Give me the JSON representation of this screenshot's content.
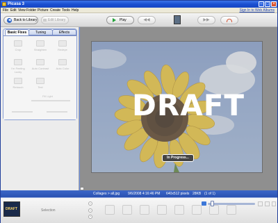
{
  "window": {
    "title": "Picasa 3"
  },
  "menu": [
    "File",
    "Edit",
    "View",
    "Folder",
    "Picture",
    "Create",
    "Tools",
    "Help"
  ],
  "signin_label": "Sign In to Web Albums",
  "toolbar": {
    "back_label": "Back to Library",
    "edit_library_label": "Edit Library",
    "play_label": "Play"
  },
  "left_panel": {
    "tabs": [
      "Basic Fixes",
      "Tuning",
      "Effects"
    ],
    "fixes": [
      "Crop",
      "Straighten",
      "Redeye",
      "I'm Feeling Lucky",
      "Auto Contrast",
      "Auto Color",
      "Retouch",
      "Text",
      "Fill Light"
    ]
  },
  "canvas": {
    "overlay_text": "DRAFT",
    "progress_label": "In Progress..."
  },
  "status": {
    "file": "Collages > all.jpg",
    "date": "9/6/2008 4:16:46 PM",
    "dimensions": "640x512 pixels",
    "size": "28KB",
    "index": "(1 of 1)"
  },
  "tray": {
    "thumb_label": "DRAFT",
    "selection_label": "Selection"
  },
  "colors": {
    "titlebar": "#1b4fd0",
    "statusbar": "#2a52b2",
    "canvas_bg": "#8f8f8f"
  }
}
